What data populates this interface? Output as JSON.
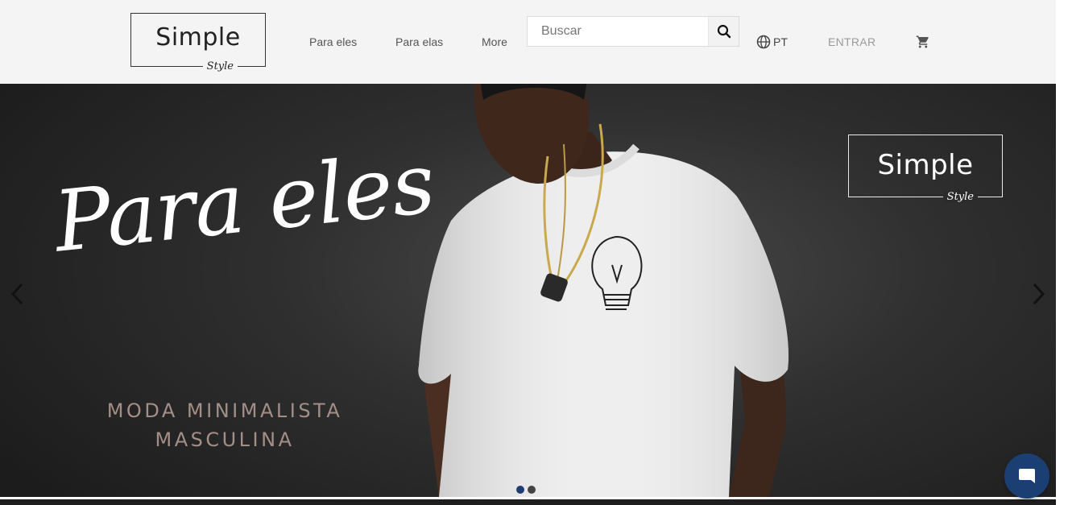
{
  "brand": {
    "name": "Simple",
    "tagline": "Style"
  },
  "nav": {
    "items": [
      "Para eles",
      "Para elas",
      "More"
    ]
  },
  "search": {
    "placeholder": "Buscar"
  },
  "language": {
    "code": "PT"
  },
  "login": {
    "label": "ENTRAR"
  },
  "hero": {
    "title": "Para eles",
    "subtitle_line1": "MODA MINIMALISTA",
    "subtitle_line2": "MASCULINA",
    "logo_name": "Simple",
    "logo_tagline": "Style",
    "slide_count": 2,
    "active_slide": 1
  },
  "colors": {
    "accent": "#1c3f73",
    "header_bg": "#f4f4f4",
    "hero_text_sub": "#a48f86"
  },
  "icons": {
    "search": "search-icon",
    "language": "globe-icon",
    "cart": "cart-icon",
    "prev": "chevron-left-icon",
    "next": "chevron-right-icon",
    "chat": "chat-bubble-icon"
  }
}
